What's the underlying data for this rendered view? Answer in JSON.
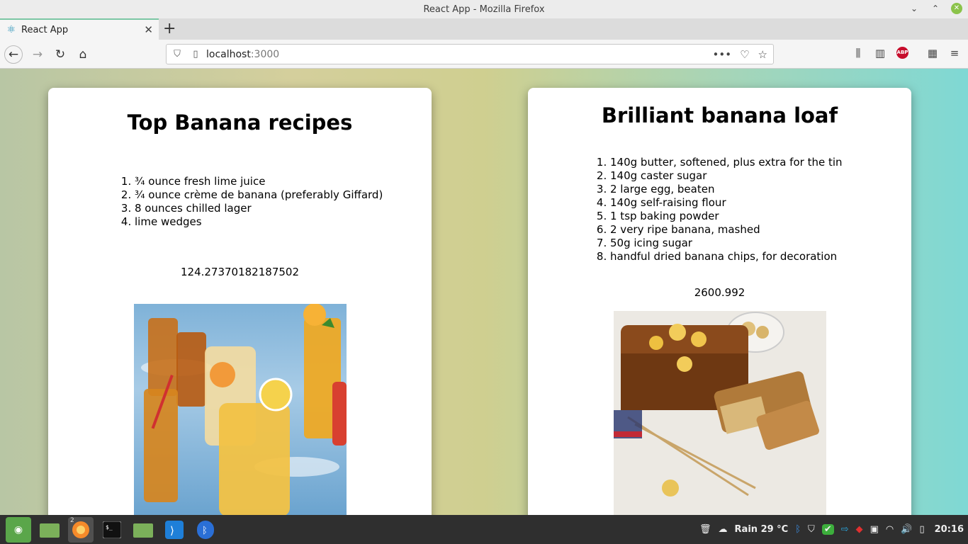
{
  "window": {
    "title": "React App - Mozilla Firefox"
  },
  "tab": {
    "title": "React App"
  },
  "urlbar": {
    "host": "localhost",
    "port": ":3000"
  },
  "cards": [
    {
      "title": "Top Banana recipes",
      "ingredients": [
        "¾ ounce fresh lime juice",
        "¾ ounce crème de banana (preferably Giffard)",
        "8 ounces chilled lager",
        "lime wedges"
      ],
      "value": "124.27370182187502"
    },
    {
      "title": "Brilliant banana loaf",
      "ingredients": [
        "140g butter, softened, plus extra for the tin",
        "140g caster sugar",
        "2 large egg, beaten",
        "140g self-raising flour",
        "1 tsp baking powder",
        "2 very ripe banana, mashed",
        "50g icing sugar",
        "handful dried banana chips, for decoration"
      ],
      "value": "2600.992"
    }
  ],
  "taskbar": {
    "firefox_badge": "2",
    "weather": "Rain 29 °C",
    "clock": "20:16"
  }
}
